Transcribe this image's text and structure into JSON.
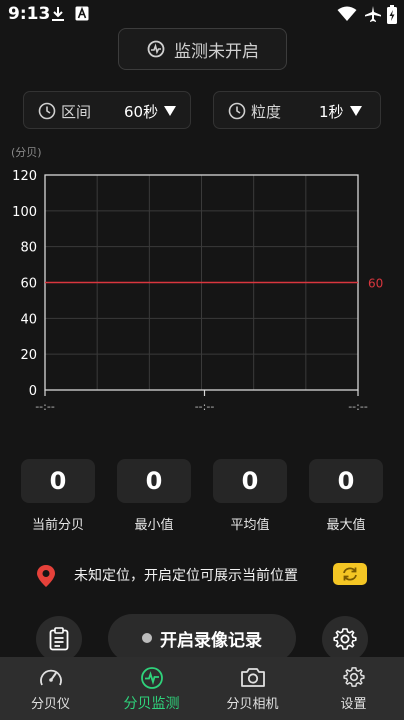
{
  "status_bar": {
    "time": "9:13"
  },
  "monitor_button": {
    "label": "监测未开启"
  },
  "interval_selector": {
    "label": "区间",
    "value": "60秒"
  },
  "granularity_selector": {
    "label": "粒度",
    "value": "1秒"
  },
  "chart_data": {
    "type": "line",
    "unit_label": "(分贝)",
    "ylim": [
      0,
      120
    ],
    "y_ticks": [
      "120",
      "100",
      "80",
      "60",
      "40",
      "20",
      "0"
    ],
    "x_ticks": [
      "--:--",
      "--:--",
      "--:--"
    ],
    "grid": true,
    "reference_line": {
      "value": 60,
      "label": "60",
      "color": "#d9363e"
    },
    "series": []
  },
  "stats": [
    {
      "value": "0",
      "label": "当前分贝"
    },
    {
      "value": "0",
      "label": "最小值"
    },
    {
      "value": "0",
      "label": "平均值"
    },
    {
      "value": "0",
      "label": "最大值"
    }
  ],
  "location": {
    "text": "未知定位，开启定位可展示当前位置"
  },
  "record_button": {
    "label": "开启录像记录"
  },
  "nav": [
    {
      "label": "分贝仪",
      "icon": "gauge-icon"
    },
    {
      "label": "分贝监测",
      "icon": "pulse-icon"
    },
    {
      "label": "分贝相机",
      "icon": "camera-icon"
    },
    {
      "label": "设置",
      "icon": "gear-icon"
    }
  ],
  "colors": {
    "accent": "#2fd27b",
    "reference": "#d9363e",
    "location_pin": "#e5413a",
    "refresh": "#f4c624"
  }
}
